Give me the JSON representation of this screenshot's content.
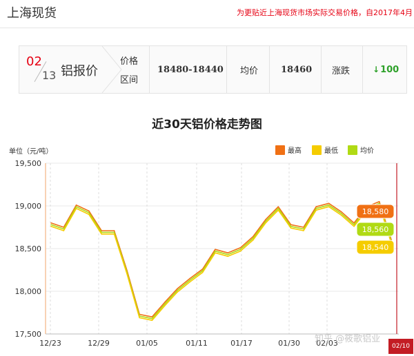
{
  "header": {
    "title": "上海现货",
    "notice": "为更贴近上海现货市场实际交易价格，自2017年4月"
  },
  "quote": {
    "month": "02",
    "day": "13",
    "name": "铝报价",
    "range_label_1": "价格",
    "range_label_2": "区间",
    "range_value": "18480-18440",
    "avg_label": "均价",
    "avg_value": "18460",
    "change_label": "涨跌",
    "change_value": "100",
    "change_arrow": "↓",
    "change_color": "#2ea12a"
  },
  "chart": {
    "unit_label": "单位（元/吨）",
    "legend": {
      "high": "最高",
      "low": "最低",
      "avg": "均价"
    },
    "colors": {
      "high": "#f07014",
      "low": "#f5cc00",
      "avg": "#b0da14"
    },
    "watermark": "知乎 @筱歌铝业",
    "date_badge": "02/10"
  },
  "chart_data": {
    "type": "line",
    "title": "近30天铝价格走势图",
    "ylim": [
      17500,
      19500
    ],
    "yticks": [
      "19,500",
      "19,000",
      "18,500",
      "18,000",
      "17,500"
    ],
    "x_tick_labels": [
      "12/23",
      "12/29",
      "01/05",
      "01/11",
      "01/17",
      "01/30",
      "02/03"
    ],
    "grid": true,
    "legend_position": "top-right",
    "series": [
      {
        "name": "最高",
        "values": [
          18800,
          18750,
          19010,
          18940,
          18710,
          18710,
          18250,
          17730,
          17700,
          17870,
          18030,
          18150,
          18260,
          18490,
          18450,
          18510,
          18640,
          18840,
          18990,
          18780,
          18750,
          18990,
          19030,
          18930,
          18800,
          18990,
          19050,
          18580
        ]
      },
      {
        "name": "最低",
        "values": [
          18760,
          18710,
          18970,
          18900,
          18670,
          18670,
          18210,
          17690,
          17660,
          17830,
          17990,
          18110,
          18220,
          18450,
          18410,
          18470,
          18600,
          18800,
          18950,
          18740,
          18710,
          18950,
          18990,
          18890,
          18760,
          18950,
          19010,
          18540
        ]
      },
      {
        "name": "均价",
        "values": [
          18780,
          18730,
          18990,
          18920,
          18690,
          18690,
          18230,
          17710,
          17680,
          17850,
          18010,
          18130,
          18240,
          18470,
          18430,
          18490,
          18620,
          18820,
          18970,
          18760,
          18730,
          18970,
          19010,
          18910,
          18780,
          18970,
          19030,
          18560
        ]
      }
    ],
    "tooltip_values": {
      "high": "18,580",
      "avg": "18,560",
      "low": "18,540"
    }
  }
}
